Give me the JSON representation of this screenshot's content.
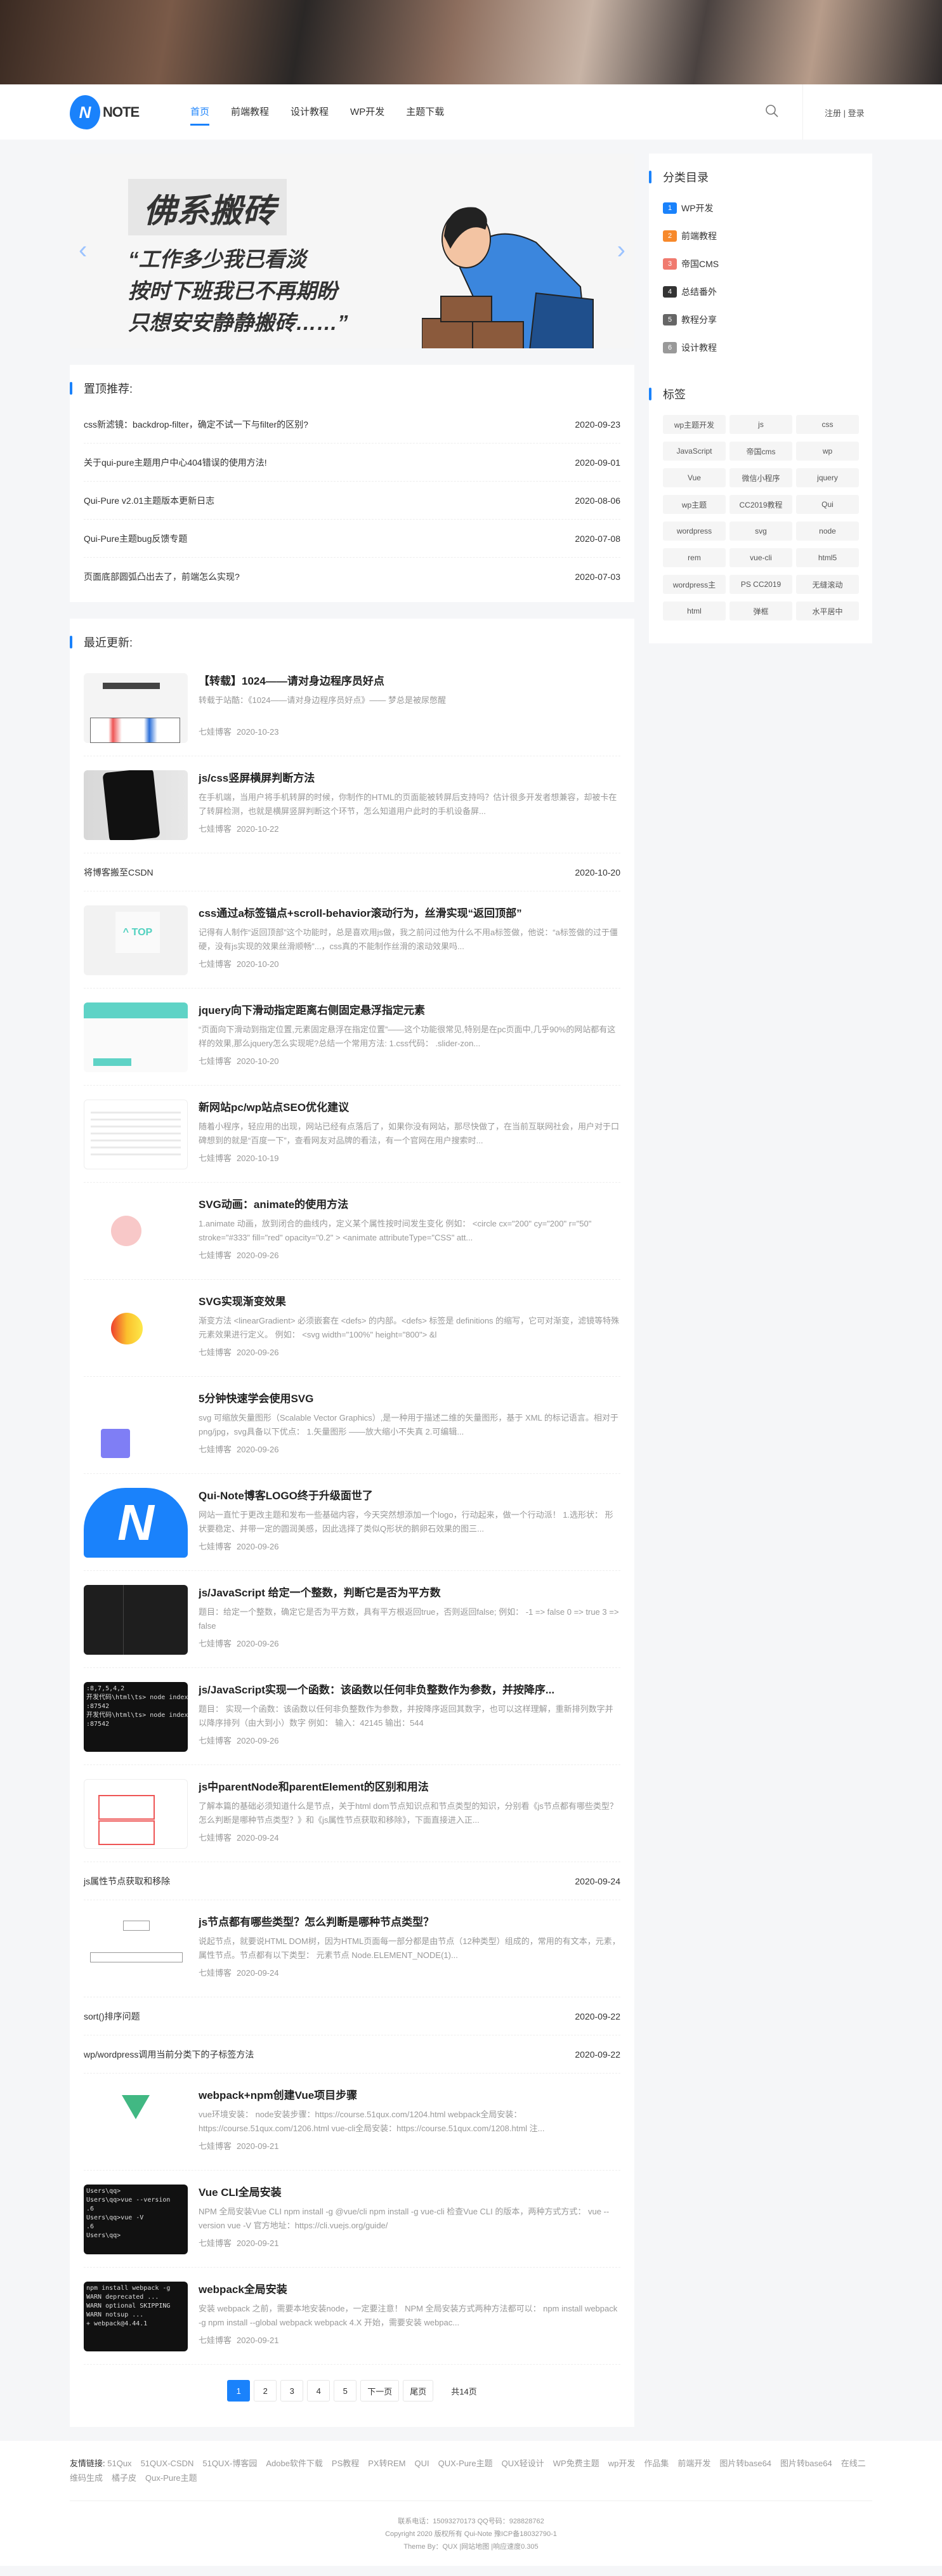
{
  "header": {
    "logo_letter": "N",
    "logo_text": "NOTE",
    "nav": [
      {
        "label": "首页",
        "active": true
      },
      {
        "label": "前端教程"
      },
      {
        "label": "设计教程"
      },
      {
        "label": "WP开发"
      },
      {
        "label": "主题下载"
      }
    ],
    "search_icon": "search-icon",
    "auth": "注册 | 登录"
  },
  "banner": {
    "title": "佛系搬砖",
    "lines": [
      "“工作多少我已看淡",
      "按时下班我已不再期盼",
      "只想安安静静搬砖……”"
    ],
    "prev": "‹",
    "next": "›"
  },
  "pinned": {
    "heading": "置顶推荐:",
    "items": [
      {
        "title": "css新滤镜：backdrop-filter，确定不试一下与filter的区别?",
        "date": "2020-09-23"
      },
      {
        "title": "关于qui-pure主题用户中心404错误的使用方法!",
        "date": "2020-09-01"
      },
      {
        "title": "Qui-Pure v2.01主题版本更新日志",
        "date": "2020-08-06"
      },
      {
        "title": "Qui-Pure主题bug反馈专题",
        "date": "2020-07-08"
      },
      {
        "title": "页面底部圆弧凸出去了，前端怎么实现?",
        "date": "2020-07-03"
      }
    ]
  },
  "recent": {
    "heading": "最近更新:",
    "posts": [
      {
        "type": "thumb",
        "title": "【转载】1024——请对身边程序员好点",
        "excerpt": "转载于站酷：《1024——请对身边程序员好点》—— 梦总是被尿憋醒",
        "author": "七娃博客",
        "date": "2020-10-23"
      },
      {
        "type": "thumb",
        "title": "js/css竖屏横屏判断方法",
        "excerpt": "在手机端，当用户将手机转屏的时候，你制作的HTML的页面能被转屏后支持吗？估计很多开发者想兼容，却被卡在了转屏检测，也就是横屏竖屏判断这个环节，怎么知道用户此时的手机设备屏...",
        "author": "七娃博客",
        "date": "2020-10-22"
      },
      {
        "type": "text",
        "title": "将博客搬至CSDN",
        "date": "2020-10-20"
      },
      {
        "type": "thumb",
        "title": "css通过a标签锚点+scroll-behavior滚动行为，丝滑实现“返回顶部”",
        "excerpt": "记得有人制作“返回顶部”这个功能时，总是喜欢用js做，我之前问过他为什么不用a标签做，他说：“a标签做的过于僵硬，没有js实现的效果丝滑顺畅”...，css真的不能制作丝滑的滚动效果吗...",
        "author": "七娃博客",
        "date": "2020-10-20"
      },
      {
        "type": "thumb",
        "title": "jquery向下滑动指定距离右侧固定悬浮指定元素",
        "excerpt": "“页面向下滑动到指定位置,元素固定悬浮在指定位置”——这个功能很常见,特别是在pc页面中,几乎90%的网站都有这样的效果,那么jquery怎么实现呢?总结一个常用方法: 1.css代码： .slider-zon...",
        "author": "七娃博客",
        "date": "2020-10-20"
      },
      {
        "type": "thumb",
        "title": "新网站pc/wp站点SEO优化建议",
        "excerpt": "随着小程序，轻应用的出现，网站已经有点落后了，如果你没有网站，那尽快做了，在当前互联网社会，用户对于口碑想到的就是“百度一下”，查看网友对品牌的看法，有一个官网在用户搜索时...",
        "author": "七娃博客",
        "date": "2020-10-19"
      },
      {
        "type": "thumb",
        "title": "SVG动画：animate的使用方法",
        "excerpt": "1.animate 动画，放到闭合的曲线内，定义某个属性按时间发生变化 例如： <circle cx=\"200\" cy=\"200\" r=\"50\" stroke=\"#333\" fill=\"red\" opacity=\"0.2\" > <animate attributeType=\"CSS\" att...",
        "author": "七娃博客",
        "date": "2020-09-26"
      },
      {
        "type": "thumb",
        "title": "SVG实现渐变效果",
        "excerpt": "渐变方法 <linearGradient> 必须嵌套在 <defs> 的内部。<defs> 标签是 definitions 的缩写，它可对渐变，滤镜等特殊元素效果进行定义。 例如： <svg width=\"100%\" height=\"800\"> &l",
        "author": "七娃博客",
        "date": "2020-09-26"
      },
      {
        "type": "thumb",
        "title": "5分钟快速学会使用SVG",
        "excerpt": "svg 可缩放矢量图形（Scalable Vector Graphics）,是一种用于描述二维的矢量图形，基于 XML 的标记语言。相对于png/jpg，svg具备以下优点： 1.矢量图形 ——放大缩小不失真 2.可编辑...",
        "author": "七娃博客",
        "date": "2020-09-26"
      },
      {
        "type": "thumb",
        "title": "Qui-Note博客LOGO终于升级面世了",
        "excerpt": "网站一直忙于更改主题和发布一些基础内容，今天突然想添加一个logo，行动起来，做一个行动派！ 1.选形状： 形状要稳定、并带一定的圆润美感，因此选择了类似Q形状的鹅卵石效果的图三...",
        "author": "七娃博客",
        "date": "2020-09-26"
      },
      {
        "type": "thumb",
        "title": "js/JavaScript 给定一个整数，判断它是否为平方数",
        "excerpt": "题目：给定一个整数，确定它是否为平方数，具有平方根返回true，否则返回false; 例如： -1 => false 0 => true 3 => false",
        "author": "七娃博客",
        "date": "2020-09-26"
      },
      {
        "type": "thumb",
        "title": "js/JavaScript实现一个函数：该函数以任何非负整数作为参数，并按降序...",
        "excerpt": "题目： 实现一个函数：该函数以任何非负整数作为参数，并按降序返回其数字，也可以这样理解，重新排列数字并以降序排列（由大到小）数字 例如： 输入：42145 输出：544",
        "author": "七娃博客",
        "date": "2020-09-26"
      },
      {
        "type": "thumb",
        "title": "js中parentNode和parentElement的区别和用法",
        "excerpt": "了解本篇的基础必须知道什么是节点，关于html dom节点知识点和节点类型的知识，分别看《js节点都有哪些类型？怎么判断是哪种节点类型？》和《js属性节点获取和移除》，下面直接进入正...",
        "author": "七娃博客",
        "date": "2020-09-24"
      },
      {
        "type": "text",
        "title": "js属性节点获取和移除",
        "date": "2020-09-24"
      },
      {
        "type": "thumb",
        "title": "js节点都有哪些类型？怎么判断是哪种节点类型？",
        "excerpt": "说起节点，就要说HTML DOM树，因为HTML页面每一部分都是由节点（12种类型）组成的，常用的有文本，元素，属性节点。节点都有以下类型： 元素节点 Node.ELEMENT_NODE(1)...",
        "author": "七娃博客",
        "date": "2020-09-24"
      },
      {
        "type": "text",
        "title": "sort()排序问题",
        "date": "2020-09-22"
      },
      {
        "type": "text",
        "title": "wp/wordpress调用当前分类下的子标签方法",
        "date": "2020-09-22"
      },
      {
        "type": "thumb",
        "title": "webpack+npm创建Vue项目步骤",
        "excerpt": "vue环境安装： node安装步骤：https://course.51qux.com/1204.html webpack全局安装：https://course.51qux.com/1206.html vue-cli全局安装：https://course.51qux.com/1208.html 注...",
        "author": "七娃博客",
        "date": "2020-09-21"
      },
      {
        "type": "thumb",
        "title": "Vue CLI全局安装",
        "excerpt": "NPM 全局安装Vue CLI npm install -g @vue/cli npm install -g vue-cli 检查Vue CLI 的版本，两种方式方式： vue --version vue -V 官方地址：https://cli.vuejs.org/guide/",
        "author": "七娃博客",
        "date": "2020-09-21"
      },
      {
        "type": "thumb",
        "title": "webpack全局安装",
        "excerpt": "安装 webpack 之前，需要本地安装node，一定要注意！ NPM 全局安装方式两种方法都可以： npm install webpack -g npm install --global webpack webpack 4.X 开始，需要安装 webpac...",
        "author": "七娃博客",
        "date": "2020-09-21"
      }
    ],
    "pagination": {
      "pages": [
        "1",
        "2",
        "3",
        "4",
        "5"
      ],
      "current": "1",
      "next": "下一页",
      "last": "尾页",
      "total": "共14页"
    }
  },
  "sidebar": {
    "categories_heading": "分类目录",
    "categories": [
      {
        "num": "1",
        "label": "WP开发",
        "color": "#1a82fb"
      },
      {
        "num": "2",
        "label": "前端教程",
        "color": "#f7892b"
      },
      {
        "num": "3",
        "label": "帝国CMS",
        "color": "#f07a6f"
      },
      {
        "num": "4",
        "label": "总结番外",
        "color": "#333333"
      },
      {
        "num": "5",
        "label": "教程分享",
        "color": "#666666"
      },
      {
        "num": "6",
        "label": "设计教程",
        "color": "#999999"
      }
    ],
    "tags_heading": "标签",
    "tags": [
      "wp主题开发",
      "js",
      "css",
      "JavaScript",
      "帝国cms",
      "wp",
      "Vue",
      "微信小程序",
      "jquery",
      "wp主题",
      "CC2019教程",
      "Qui",
      "wordpress",
      "svg",
      "node",
      "rem",
      "vue-cli",
      "html5",
      "wordpress主",
      "PS CC2019",
      "无缝滚动",
      "html",
      "弹框",
      "水平居中"
    ]
  },
  "footer": {
    "links_label": "友情链接:",
    "links": [
      "51Qux",
      "51QUX-CSDN",
      "51QUX-博客园",
      "Adobe软件下载",
      "PS教程",
      "PX转REM",
      "QUI",
      "QUX-Pure主题",
      "QUX轻设计",
      "WP免费主题",
      "wp开发",
      "作品集",
      "前端开发",
      "图片转base64",
      "图片转base64",
      "在线二维码生成",
      "橘子皮",
      "Qux-Pure主题"
    ],
    "contact": "联系电话：15093270173 QQ号码：928828762",
    "copyright": "Copyright 2020 版权所有 Qui-Note 豫ICP备18032790-1",
    "theme": "Theme By：QUX |网站地图 |响应速度0.305"
  },
  "colors": {
    "accent": "#1a82fb",
    "background": "#f5f6f8"
  }
}
